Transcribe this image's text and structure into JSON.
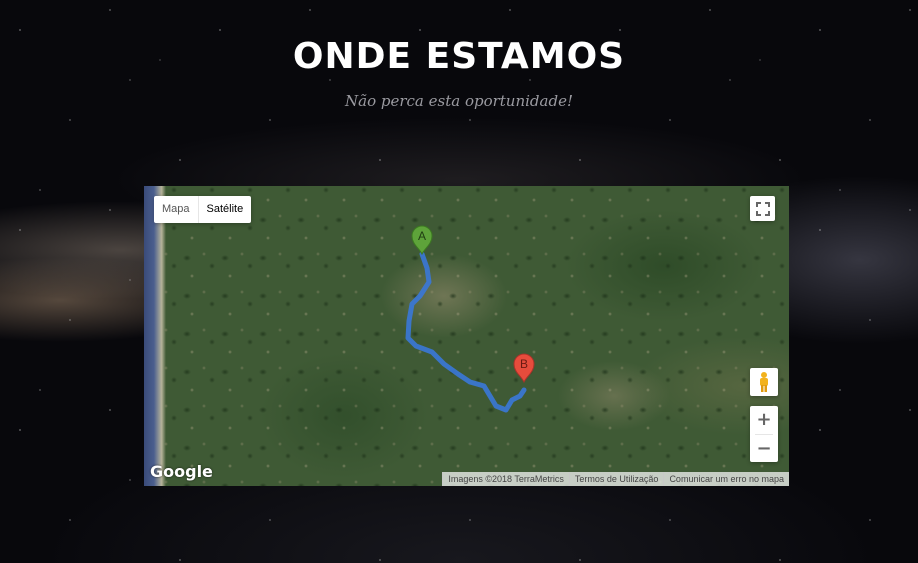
{
  "section": {
    "title": "ONDE ESTAMOS",
    "subtitle": "Não perca esta oportunidade!"
  },
  "map": {
    "type_control": {
      "map_label": "Mapa",
      "satellite_label": "Satélite",
      "selected": "Satélite"
    },
    "markers": [
      {
        "label": "A",
        "color": "#5ea33a"
      },
      {
        "label": "B",
        "color": "#e74c3c"
      }
    ],
    "route_color": "#3a78d8",
    "zoom_in_label": "+",
    "zoom_out_label": "−",
    "logo": "Google",
    "attribution": {
      "imagery": "Imagens ©2018 TerraMetrics",
      "terms": "Termos de Utilização",
      "report": "Comunicar um erro no mapa"
    },
    "icons": [
      "fullscreen-icon",
      "pegman-icon"
    ]
  }
}
